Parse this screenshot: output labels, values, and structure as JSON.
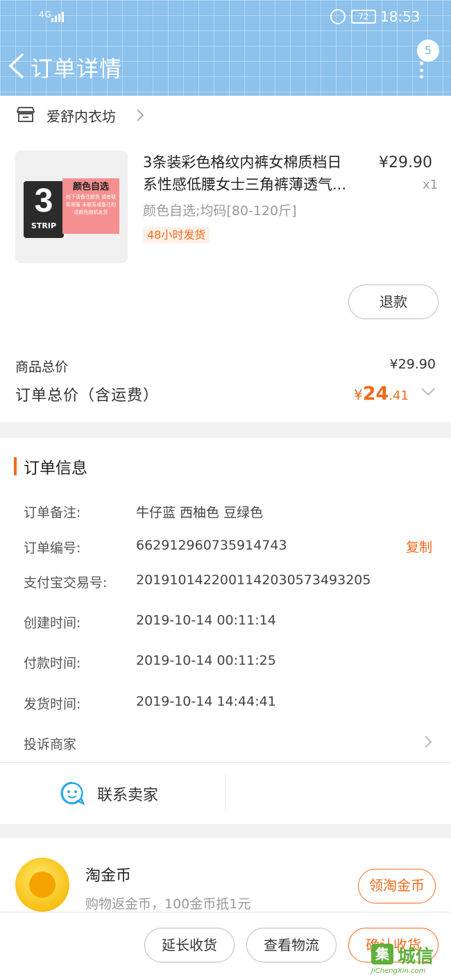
{
  "status_bar": {
    "network": "4G",
    "battery": "72",
    "time": "18:53"
  },
  "nav": {
    "title": "订单详情",
    "badge_count": "5"
  },
  "shop": {
    "name": "爱舒内衣坊"
  },
  "product": {
    "image_text": {
      "number": "3",
      "strip": "STRIP",
      "color_title": "颜色自选",
      "color_note": "拍下请备注颜色 或者联系客服 未联系或备注的 话颜色随机发货"
    },
    "title_line1": "3条装彩色格纹内裤女棉质档日",
    "title_line2": "系性感低腰女士三角裤薄透气...",
    "price": "¥29.90",
    "quantity": "x1",
    "spec": "颜色自选;均码[80-120斤]",
    "tag": "48小时发货",
    "refund_label": "退款"
  },
  "summary": {
    "goods_total_label": "商品总价",
    "goods_total_value": "¥29.90",
    "order_total_label": "订单总价（含运费）",
    "order_total_currency": "¥",
    "order_total_int": "24",
    "order_total_dec": ".41"
  },
  "order_info": {
    "section_title": "订单信息",
    "rows": [
      {
        "label": "订单备注:",
        "value": "牛仔蓝 西柚色  豆绿色"
      },
      {
        "label": "订单编号:",
        "value": "662912960735914743"
      },
      {
        "label": "支付宝交易号:",
        "value": "2019101422001142030573493205"
      },
      {
        "label": "创建时间:",
        "value": "2019-10-14 00:11:14"
      },
      {
        "label": "付款时间:",
        "value": "2019-10-14 00:11:25"
      },
      {
        "label": "发货时间:",
        "value": "2019-10-14 14:44:41"
      }
    ],
    "copy_label": "复制",
    "complain_label": "投诉商家",
    "contact_label": "联系卖家"
  },
  "coins": {
    "title": "淘金币",
    "subtitle": "购物返金币，100金币抵1元",
    "button": "领淘金币"
  },
  "bottom_bar": {
    "extend_label": "延长收货",
    "logistics_label": "查看物流",
    "confirm_label": "确认收货"
  },
  "watermark": {
    "mark": "集",
    "text": "城信",
    "url": "JiChengXin.com"
  },
  "colors": {
    "accent": "#f06a1b",
    "header_bg": "#8cc2ec",
    "contact_icon": "#2aa7e6"
  }
}
